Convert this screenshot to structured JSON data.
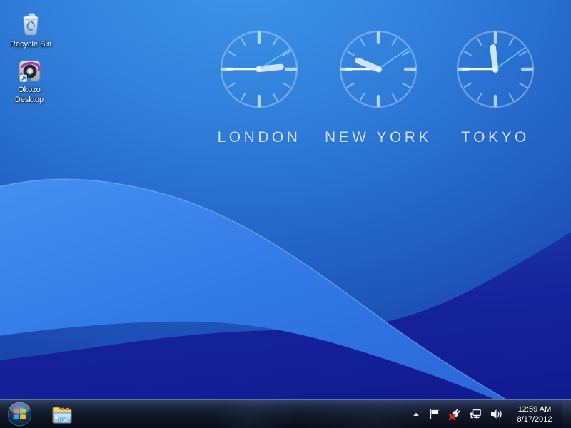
{
  "desktop": {
    "icons": [
      {
        "name": "recycle-bin",
        "label": "Recycle Bin"
      },
      {
        "name": "okozo-desktop",
        "label_line1": "Okozo",
        "label_line2": "Desktop"
      }
    ],
    "world_clocks": {
      "cities": [
        {
          "label": "LONDON",
          "hour_angle": 84,
          "minute_angle": 270,
          "second_angle": 57
        },
        {
          "label": "NEW YORK",
          "hour_angle": 293,
          "minute_angle": 270,
          "second_angle": 55
        },
        {
          "label": "TOKYO",
          "hour_angle": 354,
          "minute_angle": 270,
          "second_angle": 54
        }
      ]
    },
    "wallpaper": {
      "top_color": "#3a90e6",
      "mid_color": "#2263c6",
      "light_wave_color": "#3179e5",
      "dark_wave_color": "#141f98"
    }
  },
  "taskbar": {
    "tray_icons": [
      "show-hidden-icons",
      "action-center-flag",
      "power-plug-error",
      "network",
      "volume"
    ],
    "clock": {
      "time": "12:59 AM",
      "date": "8/17/2012"
    }
  }
}
